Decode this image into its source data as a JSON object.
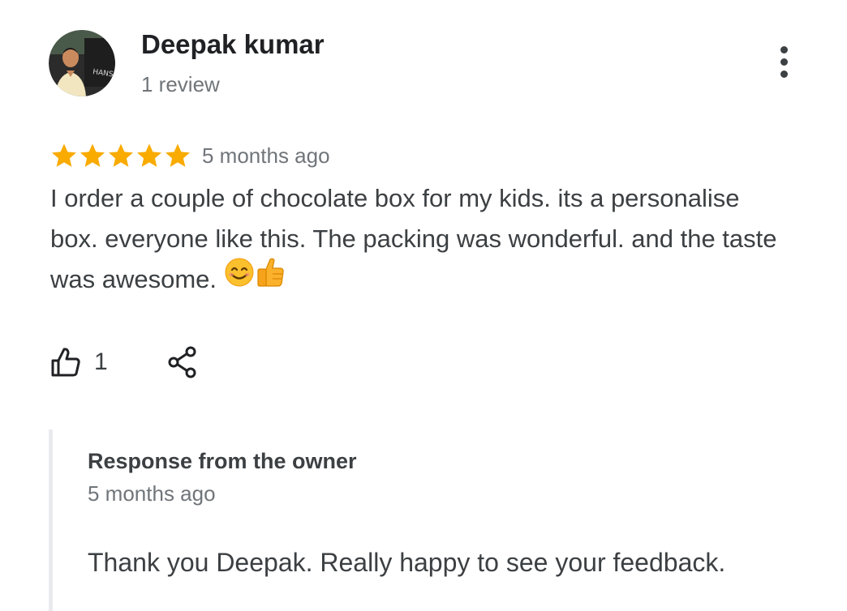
{
  "reviewer": {
    "name": "Deepak kumar",
    "review_count": "1 review",
    "avatar_icon": "avatar-photo"
  },
  "menu": {
    "icon": "more-vert-icon"
  },
  "review": {
    "rating": 5,
    "rating_max": 5,
    "star_color": "#f9ab00",
    "date": "5 months ago",
    "text": "I order a couple of chocolate box for my kids. its a personalise box. everyone like this. The packing was wonderful. and the taste was awesome.",
    "emojis": [
      "smiling-face-icon",
      "thumbs-up-icon"
    ]
  },
  "actions": {
    "like_icon": "thumb-up-outline-icon",
    "like_count": "1",
    "share_icon": "share-icon"
  },
  "owner_response": {
    "title": "Response from the owner",
    "date": "5 months ago",
    "text": "Thank you Deepak. Really happy to see your feedback."
  }
}
